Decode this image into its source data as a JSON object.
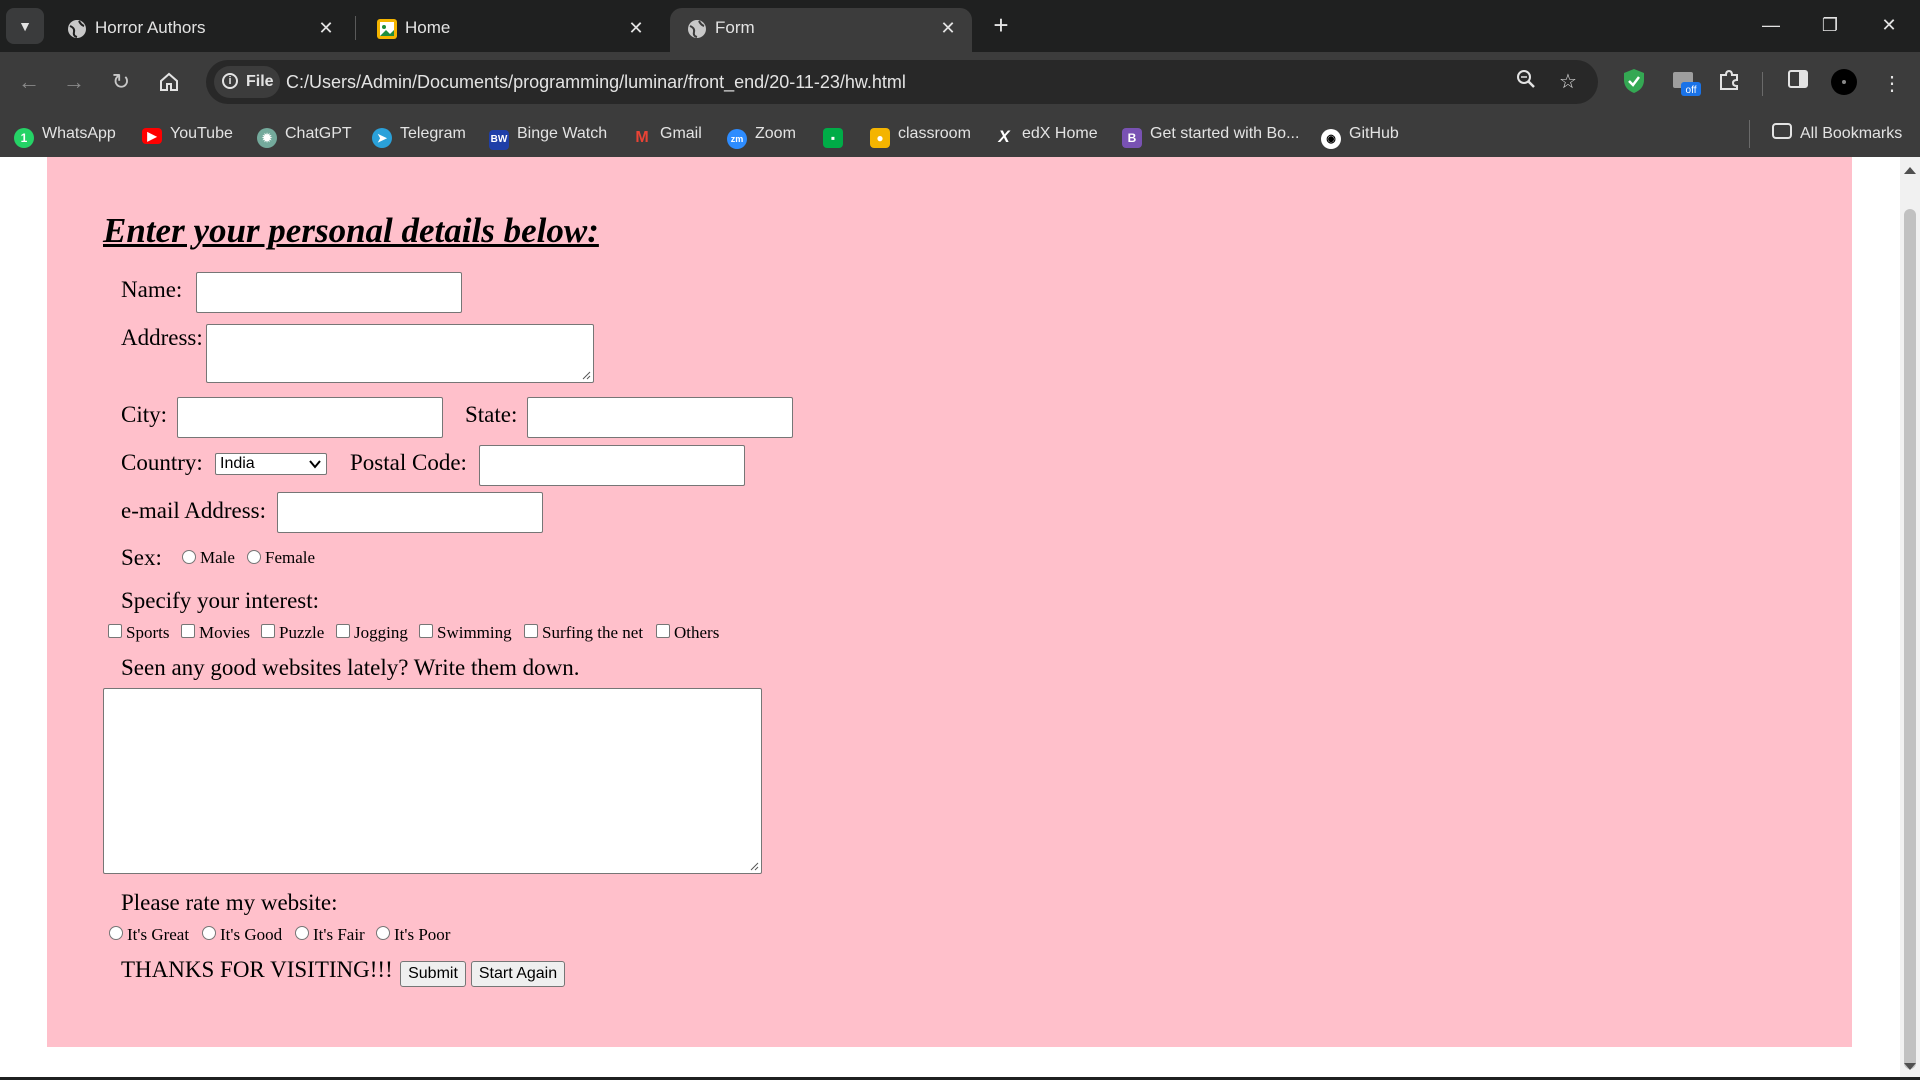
{
  "browser": {
    "tabs": [
      {
        "title": "Horror Authors",
        "icon": "globe-icon"
      },
      {
        "title": "Home",
        "icon": "image-icon"
      },
      {
        "title": "Form",
        "icon": "globe-icon",
        "active": true
      }
    ],
    "site_chip": "File",
    "url": "C:/Users/Admin/Documents/programming/luminar/front_end/20-11-23/hw.html",
    "bookmarks": [
      {
        "label": "WhatsApp",
        "icon": "whatsapp-icon",
        "color": "#25d366"
      },
      {
        "label": "YouTube",
        "icon": "youtube-icon",
        "color": "#ff0000"
      },
      {
        "label": "ChatGPT",
        "icon": "chatgpt-icon",
        "color": "#74aa9c"
      },
      {
        "label": "Telegram",
        "icon": "telegram-icon",
        "color": "#2aa1da"
      },
      {
        "label": "Binge Watch",
        "icon": "bw-icon",
        "color": "#1f3fa8"
      },
      {
        "label": "Gmail",
        "icon": "gmail-icon",
        "color": "#ea4335"
      },
      {
        "label": "Zoom",
        "icon": "zoom-icon",
        "color": "#2d8cff"
      },
      {
        "label": "",
        "icon": "meet-icon",
        "color": "#00ac47"
      },
      {
        "label": "classroom",
        "icon": "classroom-icon",
        "color": "#f4b400"
      },
      {
        "label": "edX Home",
        "icon": "edx-icon",
        "color": "#ffffff"
      },
      {
        "label": "Get started with Bo...",
        "icon": "bootstrap-icon",
        "color": "#7952b3"
      },
      {
        "label": "GitHub",
        "icon": "github-icon",
        "color": "#ffffff"
      }
    ],
    "all_bookmarks": "All Bookmarks"
  },
  "form": {
    "heading": "Enter your personal details below:",
    "name_label": "Name:",
    "address_label": "Address:",
    "city_label": "City:",
    "state_label": "State:",
    "country_label": "Country:",
    "country_value": "India",
    "postal_label": "Postal Code:",
    "email_label": "e-mail Address:",
    "sex_label": "Sex:",
    "sex_options": [
      "Male",
      "Female"
    ],
    "interest_label": "Specify your interest:",
    "interests": [
      "Sports",
      "Movies",
      "Puzzle",
      "Jogging",
      "Swimming",
      "Surfing the net",
      "Others"
    ],
    "websites_label": "Seen any good websites lately? Write them down.",
    "rate_label": "Please rate my website:",
    "ratings": [
      "It's Great",
      "It's Good",
      "It's Fair",
      "It's Poor"
    ],
    "thanks": "THANKS FOR VISITING!!!",
    "submit_label": "Submit",
    "reset_label": "Start Again"
  },
  "colors": {
    "page_background": "#ffc0cb",
    "browser_frame": "#1f2020",
    "toolbar": "#3c3c3c"
  }
}
